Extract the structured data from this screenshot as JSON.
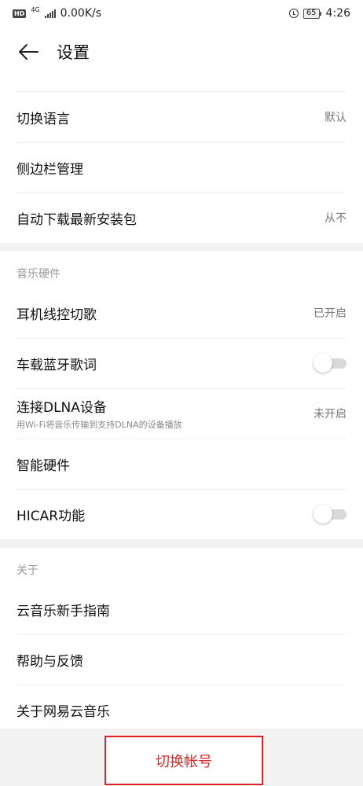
{
  "status_bar": {
    "network_type": "4G",
    "speed": "0.00K/s",
    "battery": "65",
    "time": "4:26"
  },
  "header": {
    "title": "设置"
  },
  "groups": [
    {
      "items": [
        {
          "label": "切换语言",
          "value": "默认"
        },
        {
          "label": "侧边栏管理"
        },
        {
          "label": "自动下载最新安装包",
          "value": "从不"
        }
      ]
    },
    {
      "title": "音乐硬件",
      "items": [
        {
          "label": "耳机线控切歌",
          "value": "已开启"
        },
        {
          "label": "车载蓝牙歌词",
          "toggle": false
        },
        {
          "label": "连接DLNA设备",
          "sublabel": "用Wi-Fi将音乐传输到支持DLNA的设备播放",
          "value": "未开启"
        },
        {
          "label": "智能硬件"
        },
        {
          "label": "HICAR功能",
          "toggle": false
        }
      ]
    },
    {
      "title": "关于",
      "items": [
        {
          "label": "云音乐新手指南"
        },
        {
          "label": "帮助与反馈"
        },
        {
          "label": "关于网易云音乐"
        }
      ]
    }
  ],
  "switch_account_label": "切换帐号",
  "colors": {
    "accent": "#e02424",
    "toggle_off": "#d9d9d9",
    "section_gap": "#f2f2f2"
  }
}
